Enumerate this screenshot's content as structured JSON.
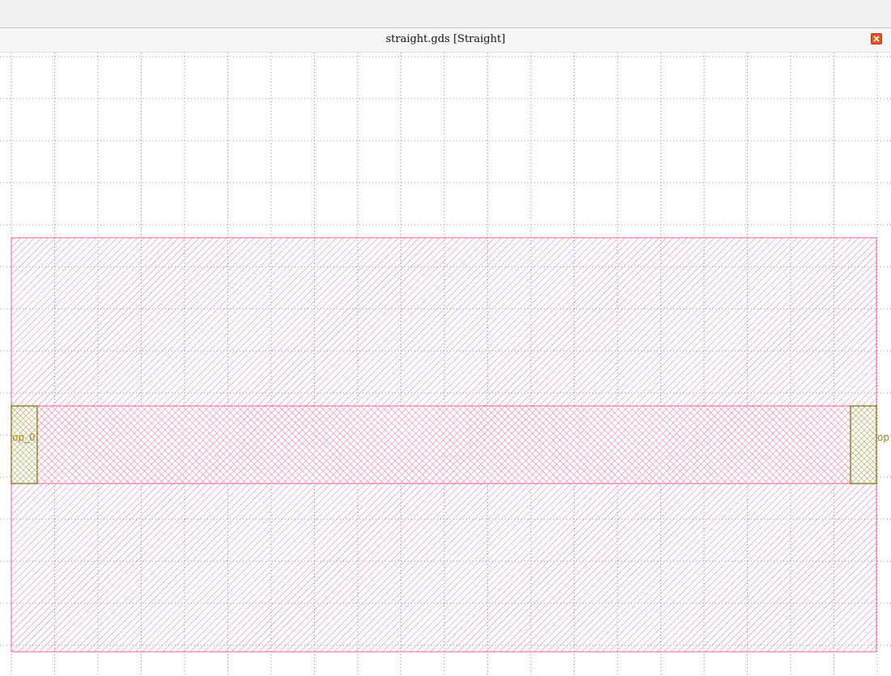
{
  "window": {
    "title": "straight.gds [Straight]"
  },
  "icons": {
    "close": "close-icon"
  },
  "layout": {
    "cell_name": "Straight",
    "file_name": "straight.gds",
    "ports": [
      {
        "name": "op_0"
      },
      {
        "name": "op"
      }
    ]
  },
  "colors": {
    "waveguide": "#f06292",
    "port": "#9e8a24",
    "port_text": "#9a8a10",
    "grid": "#9a9a9a",
    "close_button": "#e8541e"
  }
}
